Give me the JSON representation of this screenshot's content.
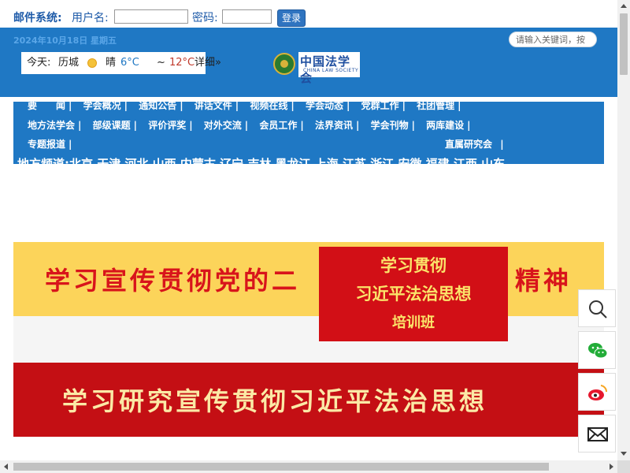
{
  "mail": {
    "title": "邮件系统:",
    "username_label": "用户名:",
    "username_value": "",
    "password_label": "密码:",
    "password_value": "",
    "login_label": "登录"
  },
  "header": {
    "date": "2024年10月18日 星期五",
    "search_placeholder": "请输入关键词，按",
    "weather": {
      "today_label": "今天:",
      "city": "历城",
      "condition": "晴",
      "low": "6°C",
      "tilde": "~",
      "high": "12°C",
      "detail": "详细»"
    },
    "logo_cn": "中国法学会",
    "logo_en": "CHINA LAW SOCIETY"
  },
  "nav": {
    "row1": [
      "要　　闻",
      "学会概况",
      "通知公告",
      "讲话文件",
      "视频在线",
      "学会动态",
      "党群工作",
      "社团管理"
    ],
    "row2": [
      "地方法学会",
      "部级课题",
      "评价评奖",
      "对外交流",
      "会员工作",
      "法界资讯",
      "学会刊物",
      "两库建设"
    ],
    "row3": [
      "专题报道"
    ],
    "row3_right": "直属研究会",
    "separator": "|",
    "regional": "地方频道:北京 天津 河北 山西 内蒙古 辽宁 吉林 黑龙江 上海 江苏 浙江 安徽 福建 江西 山东"
  },
  "banners": {
    "banner1_left": "学习宣传贯彻党的二",
    "banner1_right": "精神",
    "popup_line1": "学习贯彻",
    "popup_line2": "习近平法治思想",
    "popup_line3": "培训班",
    "banner2": "学习研究宣传贯彻习近平法治思想"
  },
  "colors": {
    "header_blue": "#1f78c4",
    "banner_red": "#c40f14",
    "banner_yellow": "#fcd45a",
    "accent_gold": "#fbe46a"
  },
  "side_icons": [
    "search-icon",
    "wechat-icon",
    "weibo-icon",
    "mail-icon"
  ]
}
